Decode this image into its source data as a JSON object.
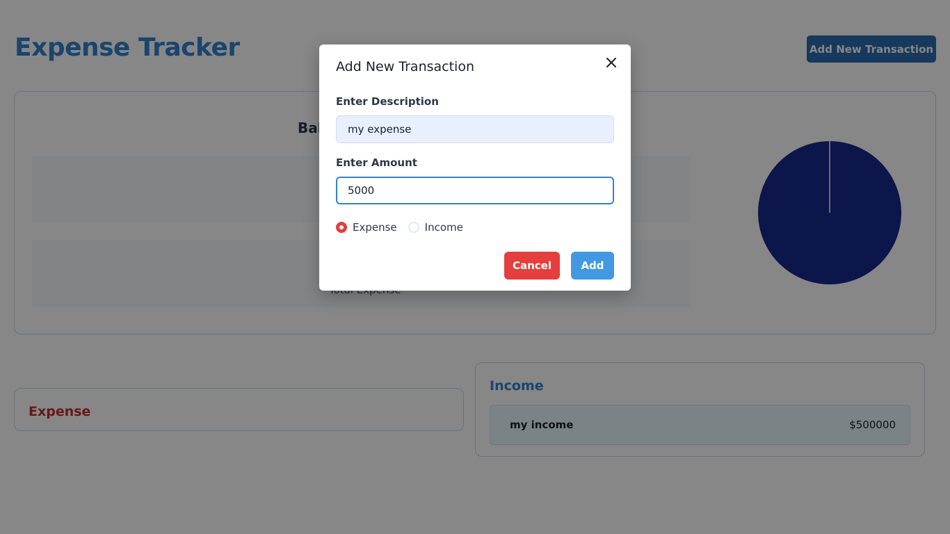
{
  "app": {
    "title": "Expense Tracker",
    "add_transaction_label": "Add New Transaction"
  },
  "summary": {
    "balance_label": "Bala",
    "balance_amount": "$",
    "total_expense_label": "Total Expense",
    "pie_colors": {
      "expense": "#ffffff",
      "income": "#1a2a8c"
    },
    "pie_values": {
      "expense": 0,
      "income": 500000
    }
  },
  "expense_list": {
    "title": "Expense",
    "items": []
  },
  "income_list": {
    "title": "Income",
    "items": [
      {
        "description": "my income",
        "amount": "$500000"
      }
    ]
  },
  "modal": {
    "title": "Add New Transaction",
    "description_label": "Enter Description",
    "description_value": "my expense",
    "amount_label": "Enter Amount",
    "amount_value": "5000",
    "radio_expense_label": "Expense",
    "radio_income_label": "Income",
    "selected_type": "Expense",
    "cancel_label": "Cancel",
    "add_label": "Add"
  },
  "colors": {
    "primary": "#3182ce",
    "danger": "#e53e3e",
    "add_button": "#4299e1"
  }
}
